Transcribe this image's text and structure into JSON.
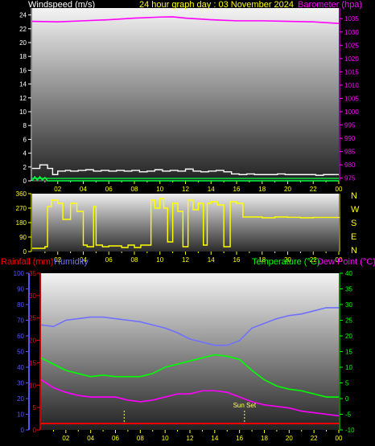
{
  "header": {
    "left_label": "Windspeed (m/s)",
    "center_label": "24 hour graph day : 03 November 2024",
    "right_label": "Barometer (hpa)"
  },
  "lower_header": {
    "rain_label": "Rainfall (mm)",
    "humidity_label": "Humidity",
    "temp_label": "Temperature (°C)",
    "dew_label": "Dew Point (°C)"
  },
  "colors": {
    "wind": "#ffffff",
    "gust": "#00ff40",
    "baro": "#ff00ff",
    "dir": "#ffff00",
    "humidity": "#7070ff",
    "temp": "#00ff00",
    "dew": "#ff00ff",
    "rain": "#ff0000",
    "axis_left": "#ffffff",
    "axis_baro": "#ff00ff",
    "axis_humid": "#5555ff",
    "axis_temp": "#00ff00",
    "axis_rain": "#ff0000",
    "ticks": "#ffff00",
    "sun": "#ffff66"
  },
  "x_ticks": [
    "02",
    "04",
    "06",
    "08",
    "10",
    "12",
    "14",
    "16",
    "18",
    "20",
    "22",
    "00"
  ],
  "sun_set_label": "Sun Set",
  "chart_data": [
    {
      "type": "line",
      "name": "wind-barometer",
      "xlim": [
        0,
        24
      ],
      "ylim_left": [
        0,
        25
      ],
      "ylim_right": [
        974,
        1039
      ],
      "y_ticks_left": [
        0,
        2,
        4,
        6,
        8,
        10,
        12,
        14,
        16,
        18,
        20,
        22,
        24
      ],
      "y_ticks_right": [
        975,
        980,
        985,
        990,
        995,
        1000,
        1005,
        1010,
        1015,
        1020,
        1025,
        1030,
        1035
      ],
      "series": [
        {
          "name": "Windspeed (m/s)",
          "axis": "left",
          "x": [
            0,
            0.6,
            1.2,
            1.6,
            2.0,
            2.6,
            3.0,
            3.6,
            4.2,
            4.8,
            5.4,
            6.0,
            6.6,
            7.2,
            7.8,
            8.4,
            9.0,
            9.6,
            10.2,
            10.8,
            11.4,
            12.0,
            12.6,
            13.2,
            13.8,
            14.4,
            15.0,
            15.6,
            16.2,
            16.8,
            17.4,
            18.0,
            18.6,
            19.2,
            19.8,
            20.4,
            21.0,
            21.6,
            22.2,
            22.8,
            23.4,
            24
          ],
          "y": [
            1.8,
            2.3,
            1.8,
            0.9,
            1.4,
            1.5,
            1.4,
            1.5,
            1.6,
            1.4,
            1.5,
            1.4,
            1.5,
            1.4,
            1.5,
            1.3,
            1.4,
            1.6,
            1.4,
            1.5,
            1.4,
            1.7,
            1.4,
            1.3,
            1.4,
            1.5,
            1.3,
            1.0,
            0.9,
            1.0,
            0.9,
            0.9,
            0.9,
            1.0,
            0.9,
            0.9,
            0.9,
            0.9,
            0.8,
            0.9,
            0.9,
            0.9
          ]
        },
        {
          "name": "Gust (m/s)",
          "axis": "left",
          "x": [
            0,
            0.2,
            0.4,
            0.6,
            0.8,
            1.0,
            1.2,
            24
          ],
          "y": [
            0.0,
            0.6,
            0.1,
            0.6,
            0.1,
            0.5,
            0.0,
            0.0
          ]
        },
        {
          "name": "Barometer (hpa)",
          "axis": "right",
          "x": [
            0,
            2,
            4,
            6,
            8,
            10,
            11,
            12,
            14,
            16,
            18,
            20,
            22,
            24
          ],
          "y": [
            1034.0,
            1033.8,
            1034.2,
            1034.6,
            1035.2,
            1035.6,
            1035.7,
            1035.2,
            1034.6,
            1034.2,
            1034.2,
            1034.0,
            1033.8,
            1033.2
          ]
        }
      ]
    },
    {
      "type": "line",
      "name": "wind-direction",
      "xlim": [
        0,
        24
      ],
      "ylim": [
        0,
        360
      ],
      "y_ticks": [
        0,
        90,
        180,
        270,
        360
      ],
      "direction_labels": [
        "N",
        "W",
        "S",
        "E",
        "N"
      ],
      "series": [
        {
          "name": "Wind direction",
          "x": [
            0,
            1.0,
            1.2,
            1.5,
            2.0,
            2.4,
            3.0,
            3.5,
            4.0,
            4.3,
            4.8,
            5.0,
            5.5,
            6.0,
            7.0,
            7.5,
            8.0,
            8.5,
            9.0,
            9.3,
            9.6,
            10.0,
            10.3,
            10.6,
            11.0,
            11.4,
            11.8,
            12.2,
            12.6,
            13.0,
            13.4,
            13.7,
            14.0,
            14.5,
            15.0,
            15.5,
            16.0,
            16.5,
            17.0,
            18.0,
            19.0,
            20.0,
            21.0,
            22.0,
            23.0,
            24.0
          ],
          "y": [
            20,
            30,
            280,
            320,
            300,
            200,
            300,
            250,
            40,
            30,
            280,
            40,
            30,
            35,
            25,
            40,
            25,
            40,
            40,
            320,
            270,
            330,
            270,
            60,
            300,
            250,
            30,
            320,
            260,
            300,
            40,
            300,
            310,
            290,
            30,
            310,
            300,
            215,
            215,
            210,
            215,
            213,
            210,
            212,
            212,
            215
          ]
        }
      ]
    },
    {
      "type": "line",
      "name": "temperature-humidity-rain",
      "xlim": [
        0,
        24
      ],
      "ylim_humidity": [
        0,
        100
      ],
      "ylim_rain": [
        0,
        35
      ],
      "ylim_temp": [
        -10,
        40
      ],
      "y_ticks_humidity": [
        0,
        10,
        20,
        30,
        40,
        50,
        60,
        70,
        80,
        90,
        100
      ],
      "y_ticks_rain": [
        0,
        5,
        10,
        15,
        20,
        25,
        30,
        35
      ],
      "y_ticks_temp": [
        -10,
        -5,
        0,
        5,
        10,
        15,
        20,
        25,
        30,
        35,
        40
      ],
      "series": [
        {
          "name": "Humidity",
          "axis": "humidity",
          "x": [
            0,
            1,
            2,
            3,
            4,
            5,
            6,
            7,
            8,
            9,
            10,
            11,
            12,
            13,
            14,
            15,
            16,
            17,
            18,
            19,
            20,
            21,
            22,
            23,
            24
          ],
          "y": [
            67,
            66,
            70,
            71,
            72,
            72,
            71,
            70,
            69,
            67,
            65,
            62,
            58,
            56,
            54,
            54,
            57,
            65,
            68,
            71,
            73,
            74,
            76,
            78,
            78
          ]
        },
        {
          "name": "Temperature (°C)",
          "axis": "temp",
          "x": [
            0,
            1,
            2,
            3,
            4,
            5,
            6,
            7,
            8,
            9,
            10,
            11,
            12,
            13,
            14,
            15,
            16,
            17,
            18,
            19,
            20,
            21,
            22,
            23,
            24
          ],
          "y": [
            13,
            11,
            9,
            8,
            7,
            7.5,
            7,
            7,
            7,
            8,
            10,
            11,
            12,
            13,
            14,
            13.5,
            12.5,
            9,
            6,
            4,
            3,
            2.5,
            1.5,
            0.5,
            0.5
          ]
        },
        {
          "name": "Dew Point (°C)",
          "axis": "temp",
          "x": [
            0,
            1,
            2,
            3,
            4,
            5,
            6,
            7,
            8,
            9,
            10,
            11,
            12,
            13,
            14,
            15,
            16,
            17,
            18,
            19,
            20,
            21,
            22,
            23,
            24
          ],
          "y": [
            6,
            3.5,
            2,
            1,
            0.5,
            0.5,
            0.5,
            -0.5,
            -1,
            -0.5,
            0.5,
            1.5,
            1.5,
            2.5,
            2.5,
            2,
            0.5,
            -1,
            -2,
            -2.5,
            -3,
            -4,
            -4.5,
            -5,
            -5.5
          ]
        },
        {
          "name": "Rainfall (mm)",
          "axis": "rain",
          "x": [
            0,
            24
          ],
          "y": [
            0,
            0
          ]
        }
      ],
      "markers": [
        {
          "label": "Sunrise",
          "x": 6.7
        },
        {
          "label": "Sun Set",
          "x": 16.4
        }
      ]
    }
  ]
}
